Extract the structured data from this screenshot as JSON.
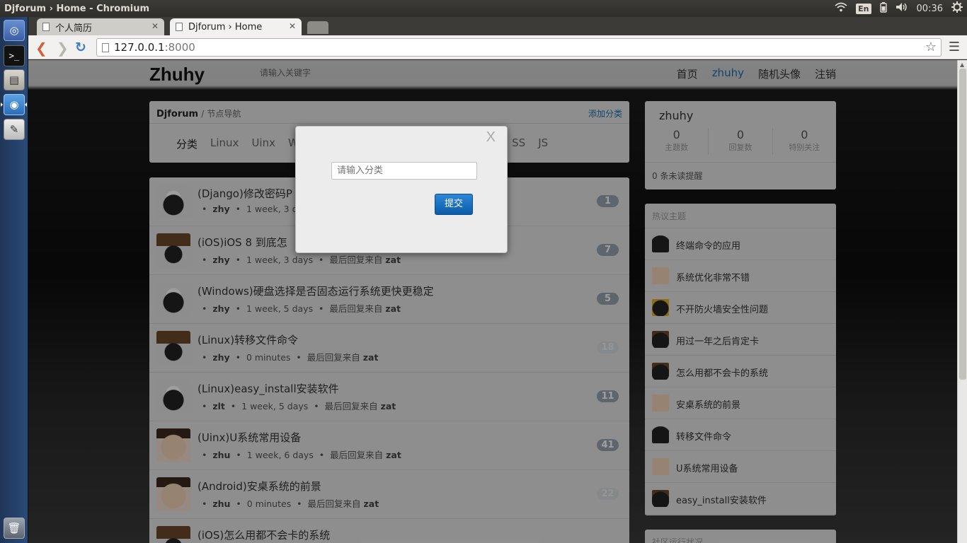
{
  "window": {
    "title": "Djforum › Home - Chromium"
  },
  "tray": {
    "lang": "En",
    "time": "00:36"
  },
  "tabs": [
    {
      "label": "个人简历"
    },
    {
      "label": "Djforum › Home"
    }
  ],
  "address": {
    "host": "127.0.0.1",
    "port": ":8000"
  },
  "site": {
    "logo": "Zhuhy",
    "search_placeholder": "请输入关键字",
    "nav": [
      "首页",
      "zhuhy",
      "随机头像",
      "注销"
    ]
  },
  "nodes": {
    "brand": "Djforum",
    "sep": "/",
    "section": "节点导航",
    "add_category": "添加分类",
    "label": "分类",
    "categories": [
      "Linux",
      "Uinx",
      "Win",
      "SS",
      "JS"
    ]
  },
  "topics": [
    {
      "title": "(Django)修改密码P",
      "author": "zhy",
      "age": "1 week, 3 d",
      "last": "",
      "lastuser": "",
      "count": "1",
      "light": false
    },
    {
      "title": "(iOS)iOS 8 到底怎",
      "author": "zhy",
      "age": "1 week, 3 days",
      "last": "最后回复来自",
      "lastuser": "zat",
      "count": "7",
      "light": false
    },
    {
      "title": "(Windows)硬盘选择是否固态运行系统更快更稳定",
      "author": "zhy",
      "age": "1 week, 5 days",
      "last": "最后回复来自",
      "lastuser": "zat",
      "count": "5",
      "light": false
    },
    {
      "title": "(Linux)转移文件命令",
      "author": "zhy",
      "age": "0 minutes",
      "last": "最后回复来自",
      "lastuser": "zat",
      "count": "18",
      "light": true
    },
    {
      "title": "(Linux)easy_install安装软件",
      "author": "zlt",
      "age": "1 week, 5 days",
      "last": "最后回复来自",
      "lastuser": "zat",
      "count": "11",
      "light": false
    },
    {
      "title": "(Uinx)U系统常用设备",
      "author": "zhu",
      "age": "1 week, 6 days",
      "last": "最后回复来自",
      "lastuser": "zat",
      "count": "41",
      "light": false
    },
    {
      "title": "(Android)安桌系统的前景",
      "author": "zhu",
      "age": "0 minutes",
      "last": "最后回复来自",
      "lastuser": "zat",
      "count": "22",
      "light": true
    },
    {
      "title": "(iOS)怎么用都不会卡的系统",
      "author": "",
      "age": "",
      "last": "",
      "lastuser": "",
      "count": "",
      "light": false
    }
  ],
  "user": {
    "name": "zhuhy",
    "stats": [
      {
        "n": "0",
        "l": "主题数"
      },
      {
        "n": "0",
        "l": "回复数"
      },
      {
        "n": "0",
        "l": "特别关注"
      }
    ],
    "unread": "0 条未读提醒"
  },
  "hot": {
    "heading": "热议主题",
    "items": [
      "终端命令的应用",
      "系统优化非常不错",
      "不开防火墙安全性问题",
      "用过一年之后肯定卡",
      "怎么用都不会卡的系统",
      "安桌系统的前景",
      "转移文件命令",
      "U系统常用设备",
      "easy_install安装软件"
    ]
  },
  "community": {
    "heading": "社区运行状况"
  },
  "modal": {
    "close": "X",
    "input_placeholder": "请输入分类",
    "submit": "提交"
  }
}
